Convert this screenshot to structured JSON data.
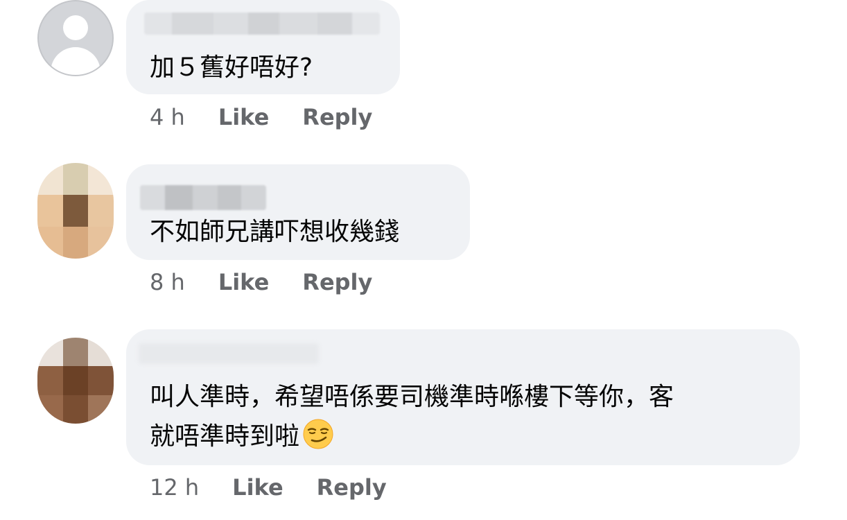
{
  "comments": [
    {
      "text": "加５舊好唔好?",
      "time": "4 h",
      "like": "Like",
      "reply": "Reply"
    },
    {
      "text": "不如師兄講吓想收幾錢",
      "time": "8 h",
      "like": "Like",
      "reply": "Reply"
    },
    {
      "text_line1": "叫人準時，希望唔係要司機準時喺樓下等你，客",
      "text_line2": "就唔準時到啦",
      "emoji": "smirking-face-emoji",
      "time": "12 h",
      "like": "Like",
      "reply": "Reply"
    }
  ],
  "colors": {
    "bubble": "#f0f2f5",
    "meta_text": "#65676b",
    "body_text": "#050505"
  }
}
